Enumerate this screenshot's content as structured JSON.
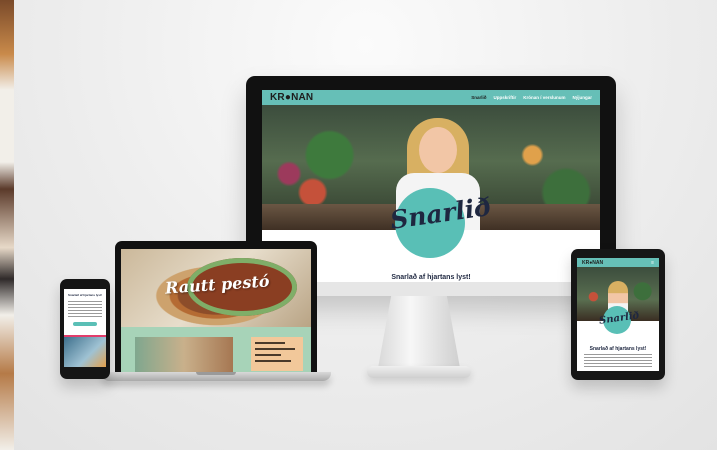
{
  "desktop": {
    "logo": "KR●NAN",
    "nav": [
      "Snarlið",
      "Uppskriftir",
      "Krónan í verslunum",
      "Nýjungar"
    ],
    "hero_badge": "Snarlið",
    "headline": "Snarlað af hjartans lyst!"
  },
  "laptop": {
    "hero_title": "Rautt pestó",
    "card_lines": [
      "Rautt pestó",
      "Innihald",
      "Aðferð"
    ]
  },
  "phone": {
    "headline": "Snarlað af hjartans lyst!"
  },
  "tablet": {
    "logo": "KR●NAN",
    "menu_icon": "≡",
    "hero_badge": "Snarlið",
    "headline": "Snarlað af hjartans lyst!"
  }
}
